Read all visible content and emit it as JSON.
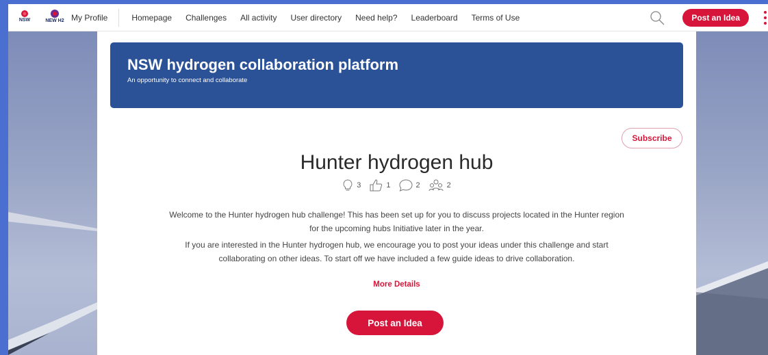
{
  "header": {
    "logos": {
      "nsw": "NSW",
      "new_h2": "NEW H2"
    },
    "my_profile": "My Profile",
    "nav": [
      "Homepage",
      "Challenges",
      "All activity",
      "User directory",
      "Need help?",
      "Leaderboard",
      "Terms of Use"
    ],
    "post_idea": "Post an Idea",
    "icons": {
      "search": "search-icon",
      "menu": "kebab-menu-icon"
    }
  },
  "banner": {
    "title": "NSW hydrogen collaboration platform",
    "subtitle": "An opportunity to connect and collaborate"
  },
  "challenge": {
    "subscribe": "Subscribe",
    "title": "Hunter hydrogen hub",
    "stats": {
      "ideas": "3",
      "likes": "1",
      "comments": "2",
      "members": "2"
    },
    "description": [
      "Welcome to the Hunter hydrogen hub challenge! This has been set up for you to discuss projects located in the Hunter region for the upcoming hubs Initiative later in the year.",
      "If you are interested in the Hunter hydrogen hub, we encourage you to post your ideas under this challenge and start collaborating on other ideas. To start off we have included a few guide ideas to drive collaboration."
    ],
    "more_details": "More Details",
    "post_idea": "Post an Idea"
  },
  "colors": {
    "accent": "#d7153a",
    "banner": "#2b5297",
    "page_edge": "#4a6fd0"
  }
}
